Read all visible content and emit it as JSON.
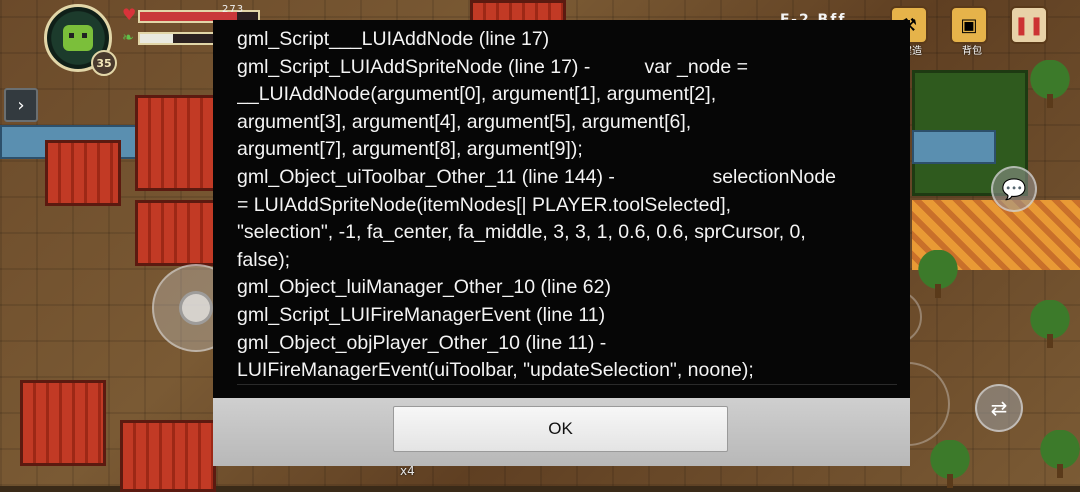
{
  "hud": {
    "hp_text": "273",
    "level": "35",
    "hp_fraction": 0.82,
    "energy_fraction": 0.28,
    "build_label": "建造",
    "backpack_label": "背包",
    "title_glimpse": "F-2 Bff",
    "item_count": "x4",
    "icons": {
      "heart": "heart-icon",
      "energy": "leaf-icon",
      "arrow": "chevron-right-icon",
      "chat": "chat-icon",
      "action": "swap-icon"
    }
  },
  "dialog": {
    "lines": [
      "gml_Script___LUIAddNode (line 17)",
      "gml_Script_LUIAddSpriteNode (line 17) -          var _node =",
      "__LUIAddNode(argument[0], argument[1], argument[2],",
      "argument[3], argument[4], argument[5], argument[6],",
      "argument[7], argument[8], argument[9]);",
      "gml_Object_uiToolbar_Other_11 (line 144) -                  selectionNode",
      "= LUIAddSpriteNode(itemNodes[| PLAYER.toolSelected],",
      "\"selection\", -1, fa_center, fa_middle, 3, 3, 1, 0.6, 0.6, sprCursor, 0,",
      "false);",
      "gml_Object_luiManager_Other_10 (line 62)",
      "gml_Script_LUIFireManagerEvent (line 11)",
      "gml_Object_objPlayer_Other_10 (line 11) -",
      "LUIFireManagerEvent(uiToolbar, \"updateSelection\", noone);"
    ],
    "ok_label": "OK"
  }
}
